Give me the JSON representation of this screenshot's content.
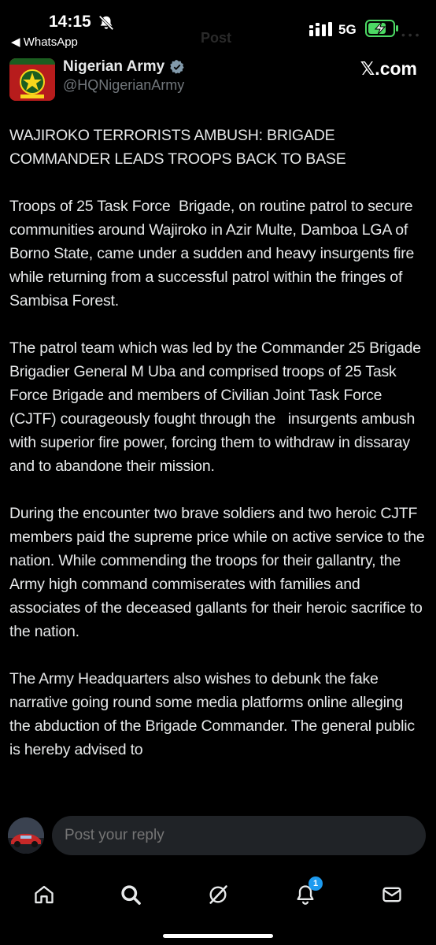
{
  "status_bar": {
    "time": "14:15",
    "back_app": "◀ WhatsApp",
    "network": "5G",
    "ghost_title": "Post",
    "ghost_more": "• • •"
  },
  "header": {
    "name": "Nigerian Army",
    "handle": "@HQNigerianArmy",
    "source": "𝕏.com"
  },
  "tweet": {
    "paragraphs": [
      "WAJIROKO TERRORISTS AMBUSH: BRIGADE COMMANDER LEADS TROOPS BACK TO BASE",
      "Troops of 25 Task Force  Brigade, on routine patrol to secure communities around Wajiroko in Azir Multe, Damboa LGA of Borno State, came under a sudden and heavy insurgents fire while returning from a successful patrol within the fringes of Sambisa Forest.",
      "The patrol team which was led by the Commander 25 Brigade Brigadier General M Uba and comprised troops of 25 Task Force Brigade and members of Civilian Joint Task Force (CJTF) courageously fought through the   insurgents ambush with superior fire power, forcing them to withdraw in dissaray and to abandone their mission.",
      "During the encounter two brave soldiers and two heroic CJTF members paid the supreme price while on active service to the nation. While commending the troops for their gallantry, the Army high command commiserates with families and associates of the deceased gallants for their heroic sacrifice to the nation.",
      "The Army Headquarters also wishes to debunk the fake narrative going round some media platforms online alleging the abduction of the Brigade Commander. The general public is hereby advised to"
    ]
  },
  "reply": {
    "placeholder": "Post your reply"
  },
  "nav": {
    "notifications_badge": "1",
    "icons": [
      "home-icon",
      "search-icon",
      "grok-icon",
      "notifications-icon",
      "messages-icon"
    ]
  },
  "colors": {
    "background": "#000000",
    "text": "#e7e9ea",
    "muted": "#71767b",
    "accent": "#1d9bf0",
    "battery": "#4cd964"
  }
}
